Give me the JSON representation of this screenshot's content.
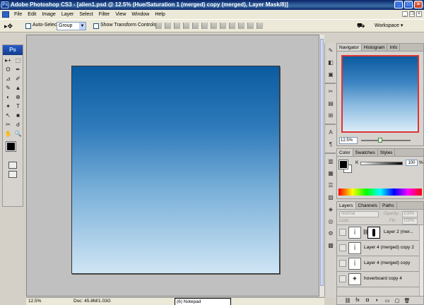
{
  "app": {
    "title": "Adobe Photoshop CS3 - [alien1.psd @ 12.5% (Hue/Saturation 1 (merged) copy (merged), Layer Mask/8)]",
    "window_buttons": [
      "_",
      "□",
      "×"
    ]
  },
  "menu": {
    "items": [
      "File",
      "Edit",
      "Image",
      "Layer",
      "Select",
      "Filter",
      "View",
      "Window",
      "Help"
    ]
  },
  "options": {
    "auto_select_label": "Auto-Select:",
    "auto_select_value": "Group",
    "show_transform_label": "Show Transform Controls",
    "workspace_label": "Workspace ▾"
  },
  "toolbox": {
    "logo": "Ps",
    "tools": [
      "▸+",
      "⬚",
      "ʘ",
      "✒",
      "⊿",
      "✐",
      "✎",
      "▲",
      "◐",
      "⊕",
      "✦",
      "T",
      "↖",
      "■",
      "✂",
      "☌",
      "✋",
      "🔍"
    ]
  },
  "status": {
    "zoom": "12.5%",
    "doc": "Doc: 45.8M/1.03G",
    "taskbar_item": "(6) Notepad"
  },
  "navigator": {
    "tabs": [
      "Navigator",
      "Histogram",
      "Info"
    ],
    "zoom": "12.5%"
  },
  "color": {
    "tabs": [
      "Color",
      "Swatches",
      "Styles"
    ],
    "channel_label": "K",
    "value": "100",
    "unit": "%"
  },
  "layers": {
    "tabs": [
      "Layers",
      "Channels",
      "Paths"
    ],
    "blend_mode": "Normal",
    "opacity_label": "Opacity:",
    "opacity_value": "100%",
    "lock_label": "Lock:",
    "fill_label": "Fill:",
    "fill_value": "100%",
    "rows": [
      {
        "name": "Layer 2 (mer..."
      },
      {
        "name": "Layer 4 (merged) copy 2"
      },
      {
        "name": "Layer 4 (merged) copy"
      },
      {
        "name": "hoverboard copy 4"
      }
    ]
  },
  "colors": {
    "titlebar": "#0a246a",
    "canvas_top": "#0b5ba0",
    "canvas_bottom": "#cfe5f4",
    "navigator_border": "#e03333"
  }
}
